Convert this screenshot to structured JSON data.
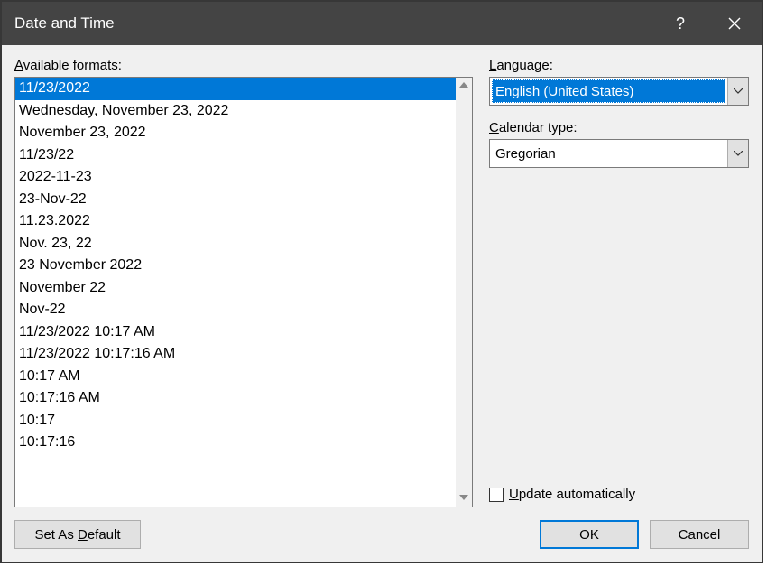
{
  "title": "Date and Time",
  "labels": {
    "available_formats_pre": "A",
    "available_formats_rest": "vailable formats:",
    "language_pre": "L",
    "language_rest": "anguage:",
    "calendar_type_pre": "C",
    "calendar_type_rest": "alendar type:",
    "update_pre": "U",
    "update_rest": "pdate automatically",
    "set_default_pre": "Set As ",
    "set_default_accel": "D",
    "set_default_post": "efault",
    "ok": "OK",
    "cancel": "Cancel"
  },
  "formats": [
    "11/23/2022",
    "Wednesday, November 23, 2022",
    "November 23, 2022",
    "11/23/22",
    "2022-11-23",
    "23-Nov-22",
    "11.23.2022",
    "Nov. 23, 22",
    "23 November 2022",
    "November 22",
    "Nov-22",
    "11/23/2022 10:17 AM",
    "11/23/2022 10:17:16 AM",
    "10:17 AM",
    "10:17:16 AM",
    "10:17",
    "10:17:16"
  ],
  "selected_format_index": 0,
  "language": {
    "selected": "English (United States)"
  },
  "calendar_type": {
    "selected": "Gregorian"
  },
  "update_automatically": false
}
